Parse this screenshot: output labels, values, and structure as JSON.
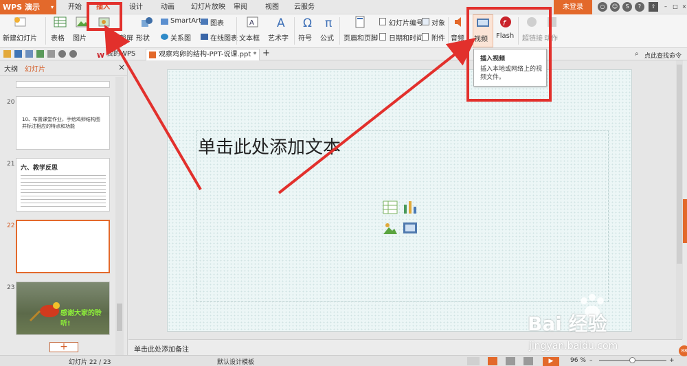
{
  "app": {
    "name": "WPS 演示",
    "drop_arrow": "▾"
  },
  "menu_tabs": [
    "开始",
    "插入",
    "设计",
    "动画",
    "幻灯片放映",
    "审阅",
    "视图",
    "云服务"
  ],
  "active_tab": "插入",
  "login_label": "未登录",
  "titlebar_icons": [
    "○",
    "☺",
    "S",
    "?",
    "⇧",
    "–",
    "□",
    "×"
  ],
  "ribbon": {
    "new_slide": "新建幻灯片",
    "table": "表格",
    "picture": "图片",
    "screenshot": "截屏",
    "shape": "形状",
    "smartart": "SmartArt",
    "chart": "图表",
    "relation": "关系图",
    "online_chart": "在线图表",
    "textbox": "文本框",
    "wordart": "艺术字",
    "symbol": "符号",
    "formula": "公式",
    "header_footer": "页眉和页脚",
    "slide_number": "幻灯片编号",
    "object": "对象",
    "date_time": "日期和时间",
    "attachment": "附件",
    "audio": "音频",
    "video": "视频",
    "flash": "Flash",
    "hyperlink": "超链接",
    "action": "动作"
  },
  "quickbar": {
    "tab_mywps": "我的WPS",
    "tab_doc": "观察鸡卵的结构-PPT-说课.ppt *",
    "new_tab": "+",
    "search": "点此查找命令"
  },
  "left_panel": {
    "tab_outline": "大纲",
    "tab_slides": "幻灯片",
    "close": "×",
    "thumbs": [
      {
        "num": "20",
        "text": "10、布置课堂作业，手绘鸡卵结构图并标注相应的特点和功能"
      },
      {
        "num": "21",
        "title": "六、教学反思"
      },
      {
        "num": "22"
      },
      {
        "num": "23",
        "caption": "感谢大家的聆听!"
      }
    ],
    "add_slide": "+"
  },
  "slide": {
    "placeholder": "单击此处添加文本"
  },
  "notes_placeholder": "单击此处添加备注",
  "status": {
    "slide_counter": "幻灯片 22 / 23",
    "template": "默认设计模板",
    "zoom": "96 %",
    "zoom_minus": "–",
    "zoom_plus": "+"
  },
  "tooltip": {
    "title": "插入视频",
    "desc": "插入本地或网络上的视频文件。"
  },
  "watermark": {
    "line1": "Bai 经验",
    "line2": "jingyan.baidu.com",
    "badge": "88"
  },
  "colors": {
    "accent": "#e3692b",
    "annotation": "#e2302c"
  }
}
